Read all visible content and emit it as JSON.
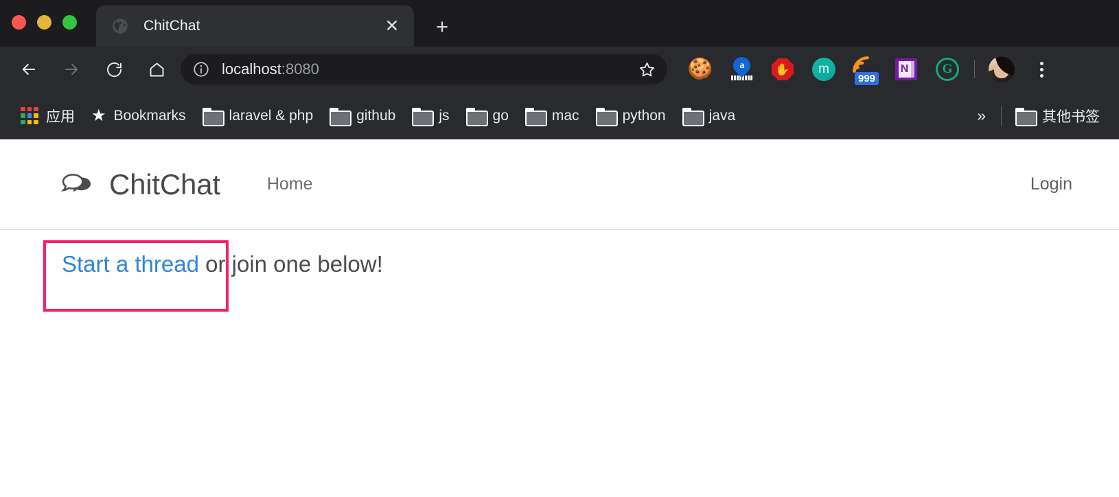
{
  "browser": {
    "traffic_lights": [
      "close",
      "minimize",
      "zoom"
    ],
    "tab": {
      "title": "ChitChat",
      "favicon": "globe-icon",
      "close_label": "✕"
    },
    "new_tab_label": "+",
    "toolbar": {
      "back_label": "←",
      "forward_label": "→",
      "reload_label": "⟳",
      "home_label": "⌂",
      "site_info_label": "ⓘ",
      "url_host": "localhost",
      "url_port": ":8080",
      "bookmark_star_label": "☆",
      "menu_label": "kebab-menu"
    },
    "extensions": [
      {
        "name": "cookie-extension",
        "glyph": "🍪",
        "badge": ""
      },
      {
        "name": "amazon-price-extension",
        "glyph": "a",
        "badge": ""
      },
      {
        "name": "adblock-extension",
        "glyph": "✋",
        "badge": ""
      },
      {
        "name": "mega-extension",
        "glyph": "m",
        "badge": ""
      },
      {
        "name": "feedly-extension",
        "glyph": "rss",
        "badge": "999"
      },
      {
        "name": "onenote-extension",
        "glyph": "N",
        "badge": ""
      },
      {
        "name": "grammarly-extension",
        "glyph": "G",
        "badge": ""
      }
    ],
    "bookmarks": [
      {
        "label": "应用",
        "icon": "apps-grid-icon"
      },
      {
        "label": "Bookmarks",
        "icon": "star-icon"
      },
      {
        "label": "laravel & php",
        "icon": "folder-icon"
      },
      {
        "label": "github",
        "icon": "folder-icon"
      },
      {
        "label": "js",
        "icon": "folder-icon"
      },
      {
        "label": "go",
        "icon": "folder-icon"
      },
      {
        "label": "mac",
        "icon": "folder-icon"
      },
      {
        "label": "python",
        "icon": "folder-icon"
      },
      {
        "label": "java",
        "icon": "folder-icon"
      }
    ],
    "bookmarks_overflow_label": "»",
    "other_bookmarks": {
      "label": "其他书签",
      "icon": "folder-icon"
    }
  },
  "site": {
    "brand": {
      "name": "ChitChat",
      "logo": "speech-bubbles-icon"
    },
    "nav_links": [
      {
        "label": "Home"
      }
    ],
    "auth_link": {
      "label": "Login"
    },
    "content": {
      "lead_link_text": "Start a thread",
      "lead_rest_text": " or join one below!"
    }
  },
  "colors": {
    "tab_strip_bg": "#1c1c1e",
    "toolbar_bg": "#292a2d",
    "active_tab_bg": "#2f3033",
    "url_pill_bg": "#1c1c1e",
    "chrome_text": "#e8eaed",
    "link_blue": "#2f86d8",
    "highlight_pink": "#f4226b",
    "body_text": "#4c4c4c"
  }
}
